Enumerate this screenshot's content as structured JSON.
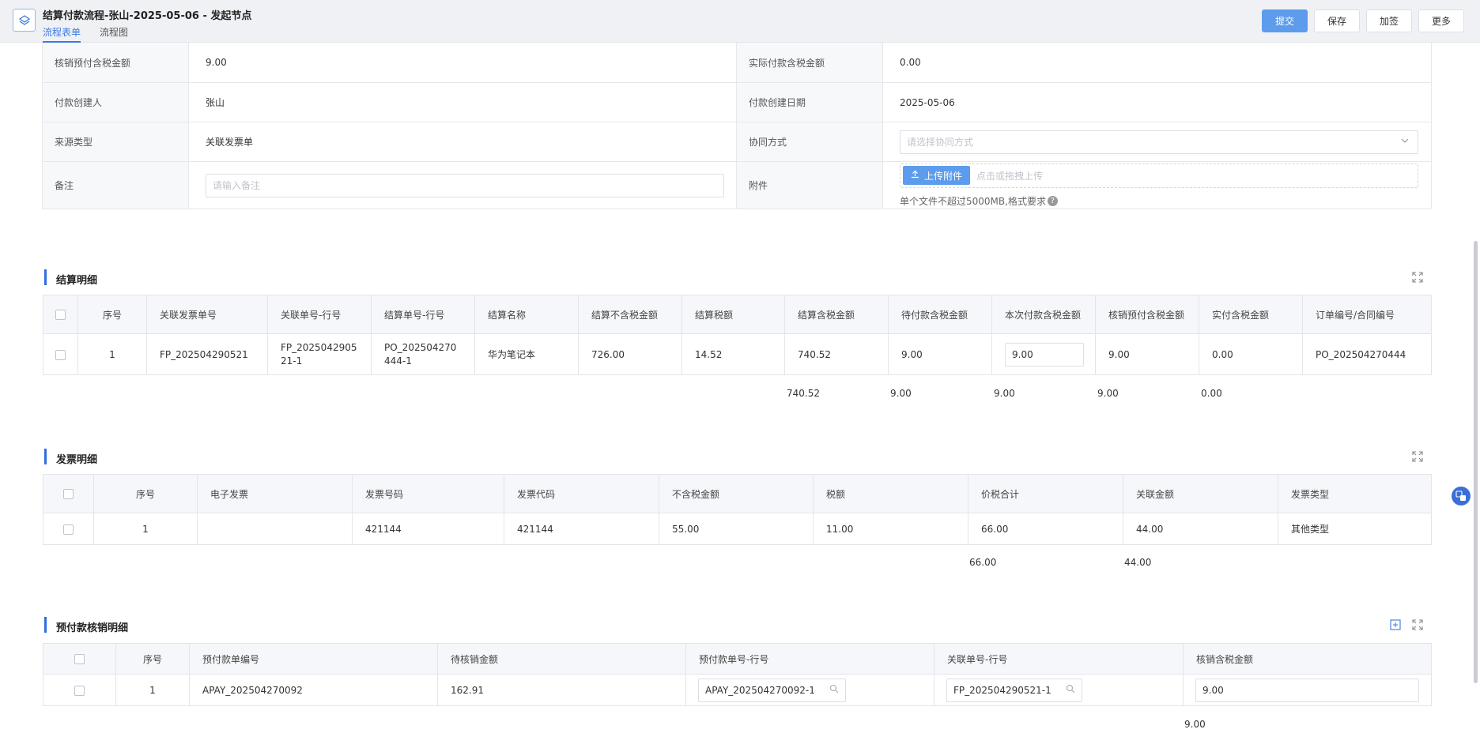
{
  "header": {
    "title": "结算付款流程-张山-2025-05-06 - 发起节点",
    "tabs": [
      "流程表单",
      "流程图"
    ],
    "buttons": {
      "submit": "提交",
      "save": "保存",
      "add_sign": "加签",
      "more": "更多"
    }
  },
  "form": {
    "rows": [
      {
        "label1": "核销预付含税金额",
        "value1": "9.00",
        "label2": "实际付款含税金额",
        "value2": "0.00"
      },
      {
        "label1": "付款创建人",
        "value1": "张山",
        "label2": "付款创建日期",
        "value2": "2025-05-06"
      },
      {
        "label1": "来源类型",
        "value1": "关联发票单",
        "label2": "协同方式"
      }
    ],
    "coop_placeholder": "请选择协同方式",
    "remark_label": "备注",
    "remark_placeholder": "请输入备注",
    "attach_label": "附件",
    "upload_label": "上传附件",
    "upload_hint": "点击或拖拽上传",
    "file_hint": "单个文件不超过5000MB,格式要求"
  },
  "settlement": {
    "title": "结算明细",
    "headers": [
      "序号",
      "关联发票单号",
      "关联单号-行号",
      "结算单号-行号",
      "结算名称",
      "结算不含税金额",
      "结算税额",
      "结算含税金额",
      "待付款含税金额",
      "本次付款含税金额",
      "核销预付含税金额",
      "实付含税金额",
      "订单编号/合同编号"
    ],
    "row": {
      "seq": "1",
      "invoice_no": "FP_202504290521",
      "rel_line": "FP_202504290521-1",
      "settle_line": "PO_202504270444-1",
      "name": "华为笔记本",
      "amt_ex_tax": "726.00",
      "tax": "14.52",
      "amt_inc_tax": "740.52",
      "pending": "9.00",
      "this_payment": "9.00",
      "writeoff": "9.00",
      "actual": "0.00",
      "order_no": "PO_202504270444"
    },
    "sums": {
      "amt_inc_tax": "740.52",
      "pending": "9.00",
      "this_payment": "9.00",
      "writeoff": "9.00",
      "actual": "0.00"
    }
  },
  "invoice": {
    "title": "发票明细",
    "headers": [
      "序号",
      "电子发票",
      "发票号码",
      "发票代码",
      "不含税金额",
      "税额",
      "价税合计",
      "关联金额",
      "发票类型"
    ],
    "row": {
      "seq": "1",
      "e_invoice": "",
      "number": "421144",
      "code": "421144",
      "ex_tax": "55.00",
      "tax": "11.00",
      "total": "66.00",
      "related": "44.00",
      "type": "其他类型"
    },
    "sums": {
      "total": "66.00",
      "related": "44.00"
    }
  },
  "prepay": {
    "title": "预付款核销明细",
    "headers": [
      "序号",
      "预付款单编号",
      "待核销金额",
      "预付款单号-行号",
      "关联单号-行号",
      "核销含税金额"
    ],
    "row": {
      "seq": "1",
      "prepay_no": "APAY_202504270092",
      "pending": "162.91",
      "prepay_line": "APAY_202504270092-1",
      "rel_line": "FP_202504290521-1",
      "writeoff": "9.00"
    },
    "sums": {
      "writeoff": "9.00"
    }
  },
  "icons": [
    "layers-icon",
    "upload-icon",
    "chevron-down-icon",
    "expand-icon",
    "add-icon",
    "search-icon",
    "translate-icon"
  ],
  "colors": {
    "primary": "#5d9cec",
    "accent": "#2f6fdc"
  }
}
